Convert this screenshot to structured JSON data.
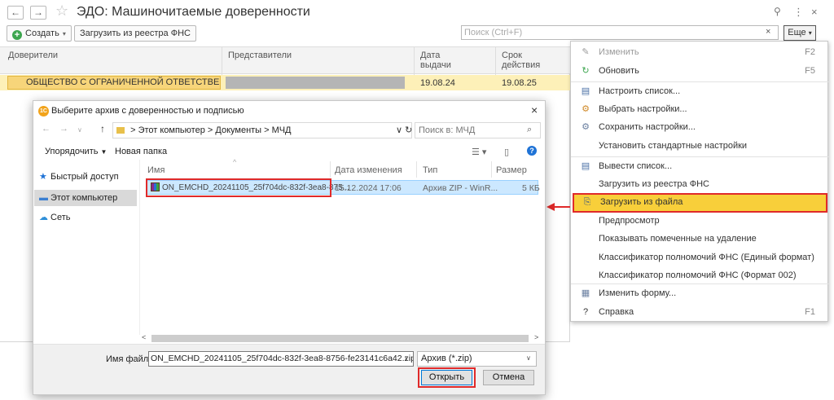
{
  "window": {
    "title": "ЭДО: Машиночитаемые доверенности",
    "back_glyph": "←",
    "forward_glyph": "→",
    "star_glyph": "☆",
    "link_glyph": "🔗",
    "more_glyph": "⋮",
    "close_glyph": "×"
  },
  "toolbar": {
    "create_label": "Создать",
    "load_registry_label": "Загрузить из реестра ФНС",
    "search_placeholder": "Поиск (Ctrl+F)",
    "clear_glyph": "×",
    "more_label": "Еще",
    "caret_glyph": "▾"
  },
  "table": {
    "headers": {
      "principals": "Доверители",
      "representatives": "Представители",
      "issue_date_1": "Дата",
      "issue_date_2": "выдачи",
      "term_1": "Срок",
      "term_2": "действия"
    },
    "rows": [
      {
        "principal": "ОБЩЕСТВО С ОГРАНИЧЕННОЙ ОТВЕТСТВЕНН...",
        "issue_date": "19.08.24",
        "term": "19.08.25"
      }
    ]
  },
  "menu": {
    "items": [
      {
        "label": "Изменить",
        "key": "F2",
        "icon": "pencil-icon",
        "glyph": "✎",
        "color": "#9a9a9a",
        "disabled": true
      },
      {
        "label": "Обновить",
        "key": "F5",
        "icon": "refresh-icon",
        "glyph": "↻",
        "color": "#3da64f",
        "disabled": false
      },
      {
        "label": "Настроить список...",
        "key": "",
        "icon": "list-settings-icon",
        "glyph": "▤",
        "color": "#4a6fa5",
        "disabled": false
      },
      {
        "label": "Выбрать настройки...",
        "key": "",
        "icon": "select-settings-icon",
        "glyph": "⚙",
        "color": "#d08a2a",
        "disabled": false
      },
      {
        "label": "Сохранить настройки...",
        "key": "",
        "icon": "save-settings-icon",
        "glyph": "⚙",
        "color": "#6a7fa0",
        "disabled": false
      },
      {
        "label": "Установить стандартные настройки",
        "key": "",
        "icon": "",
        "glyph": "",
        "color": "#333333",
        "disabled": false
      },
      {
        "label": "Вывести список...",
        "key": "",
        "icon": "export-list-icon",
        "glyph": "▤",
        "color": "#4a6fa5",
        "disabled": false
      },
      {
        "label": "Загрузить из реестра ФНС",
        "key": "",
        "icon": "",
        "glyph": "",
        "color": "#333333",
        "disabled": false
      },
      {
        "label": "Загрузить из файла",
        "key": "",
        "icon": "load-file-icon",
        "glyph": "⎘",
        "color": "#3d5a80",
        "disabled": false
      },
      {
        "label": "Предпросмотр",
        "key": "",
        "icon": "",
        "glyph": "",
        "color": "#333333",
        "disabled": false
      },
      {
        "label": "Показывать помеченные на удаление",
        "key": "",
        "icon": "",
        "glyph": "",
        "color": "#333333",
        "disabled": false
      },
      {
        "label": "Классификатор полномочий ФНС (Единый формат)",
        "key": "",
        "icon": "",
        "glyph": "",
        "color": "#333333",
        "disabled": false
      },
      {
        "label": "Классификатор полномочий ФНС (Формат 002)",
        "key": "",
        "icon": "",
        "glyph": "",
        "color": "#333333",
        "disabled": false
      },
      {
        "label": "Изменить форму...",
        "key": "",
        "icon": "change-form-icon",
        "glyph": "▦",
        "color": "#6a7fa0",
        "disabled": false
      },
      {
        "label": "Справка",
        "key": "F1",
        "icon": "help-icon",
        "glyph": "?",
        "color": "#333333",
        "disabled": false
      }
    ],
    "accent_highlight": "#f8cf3a",
    "annotation_color": "#e02a2a"
  },
  "dialog": {
    "title": "Выберите архив с доверенностью и подписью",
    "app_icon_text": "1С",
    "path": [
      "Этот компьютер",
      "Документы",
      "МЧД"
    ],
    "path_sep": ">",
    "search_placeholder": "Поиск в: МЧД",
    "organize_label": "Упорядочить",
    "new_folder_label": "Новая папка",
    "nav": [
      {
        "label": "Быстрый доступ",
        "icon": "star-icon"
      },
      {
        "label": "Этот компьютер",
        "icon": "computer-icon"
      },
      {
        "label": "Сеть",
        "icon": "network-icon"
      }
    ],
    "columns": {
      "name": "Имя",
      "modified": "Дата изменения",
      "type": "Тип",
      "size": "Размер"
    },
    "files": [
      {
        "name": "ON_EMCHD_20241105_25f704dc-832f-3ea8-875...",
        "modified": "15.12.2024 17:06",
        "type": "Архив ZIP - WinR...",
        "size": "5 КБ"
      }
    ],
    "filename_label": "Имя файла:",
    "filename_value": "ON_EMCHD_20241105_25f704dc-832f-3ea8-8756-fe23141c6a42.zip",
    "filetype_value": "Архив (*.zip)",
    "open_label": "Открыть",
    "cancel_label": "Отмена"
  }
}
